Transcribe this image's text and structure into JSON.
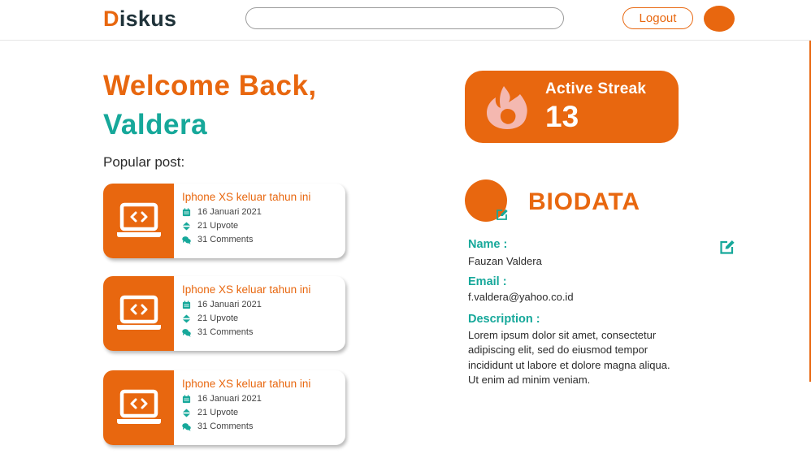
{
  "header": {
    "logo_first": "D",
    "logo_rest": "iskus",
    "search_placeholder": "",
    "logout_label": "Logout"
  },
  "welcome": {
    "line1": "Welcome Back,",
    "name": "Valdera"
  },
  "popular_label": "Popular post:",
  "posts": [
    {
      "title": "Iphone XS keluar tahun ini",
      "date": "16 Januari 2021",
      "upvotes": "21 Upvote",
      "comments": "31 Comments",
      "icon": "laptop-code-icon"
    },
    {
      "title": "Iphone XS keluar tahun ini",
      "date": "16 Januari 2021",
      "upvotes": "21 Upvote",
      "comments": "31 Comments",
      "icon": "laptop-code-icon"
    },
    {
      "title": "Iphone XS keluar tahun ini",
      "date": "16 Januari 2021",
      "upvotes": "21 Upvote",
      "comments": "31 Comments",
      "icon": "laptop-code-icon"
    }
  ],
  "streak": {
    "label": "Active Streak",
    "value": "13",
    "icon": "flame-icon"
  },
  "biodata": {
    "title": "BIODATA",
    "name_label": "Name :",
    "name_value": "Fauzan Valdera",
    "email_label": "Email :",
    "email_value": "f.valdera@yahoo.co.id",
    "description_label": "Description :",
    "description_value": "Lorem ipsum dolor sit amet, consectetur adipiscing elit, sed do eiusmod tempor incididunt ut labore et dolore magna aliqua. Ut enim ad minim veniam."
  },
  "colors": {
    "accent": "#e8670f",
    "teal": "#16a89a",
    "text": "#2b2b2b",
    "flame": "#f4b8b0"
  }
}
